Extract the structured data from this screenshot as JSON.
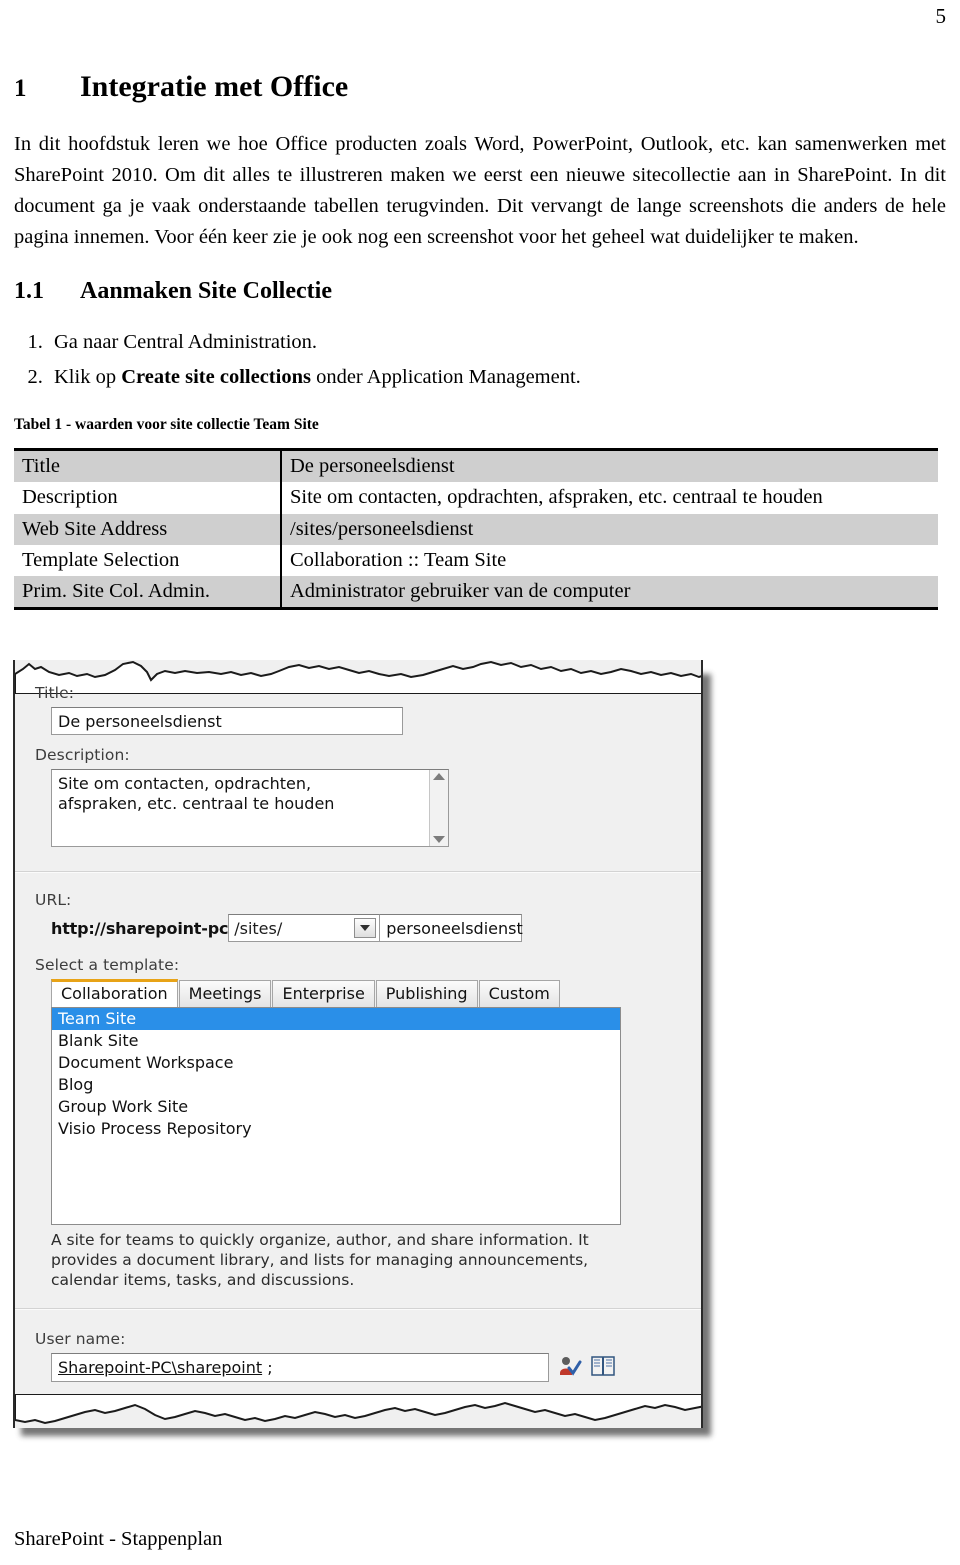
{
  "page": {
    "number": "5",
    "footer": "SharePoint - Stappenplan"
  },
  "chapter": {
    "number": "1",
    "title": "Integratie met Office",
    "intro": "In dit hoofdstuk leren we hoe Office producten zoals Word, PowerPoint, Outlook, etc. kan samenwerken met SharePoint 2010. Om dit alles te illustreren maken we eerst een nieuwe sitecollectie aan in SharePoint. In dit document ga je vaak onderstaande tabellen terugvinden. Dit vervangt de lange screenshots die anders de hele pagina innemen. Voor één keer zie je ook nog een screenshot voor het geheel wat duidelijker te maken."
  },
  "section": {
    "number": "1.1",
    "title": "Aanmaken Site Collectie",
    "steps": [
      {
        "plain_before": "Ga naar Central Administration.",
        "bold": "",
        "plain_after": ""
      },
      {
        "plain_before": "Klik op ",
        "bold": "Create site collections",
        "plain_after": " onder Application Management."
      }
    ]
  },
  "table": {
    "caption": "Tabel 1 - waarden voor site collectie Team Site",
    "rows": [
      {
        "key": "Title",
        "value": "De personeelsdienst"
      },
      {
        "key": "Description",
        "value": "Site om contacten, opdrachten, afspraken, etc. centraal te houden"
      },
      {
        "key": "Web Site Address",
        "value": "/sites/personeelsdienst"
      },
      {
        "key": "Template Selection",
        "value": "Collaboration :: Team Site"
      },
      {
        "key": "Prim. Site Col. Admin.",
        "value": "Administrator gebruiker van de computer"
      }
    ]
  },
  "screenshot": {
    "title_label": "Title:",
    "title_value": "De personeelsdienst",
    "description_label": "Description:",
    "description_value": "Site om contacten, opdrachten,\nafspraken, etc. centraal te houden",
    "url_label": "URL:",
    "url_prefix": "http://sharepoint-pc",
    "url_path": "/sites/",
    "url_tail": "personeelsdienst",
    "template_label": "Select a template:",
    "tabs": [
      {
        "label": "Collaboration",
        "active": true
      },
      {
        "label": "Meetings",
        "active": false
      },
      {
        "label": "Enterprise",
        "active": false
      },
      {
        "label": "Publishing",
        "active": false
      },
      {
        "label": "Custom",
        "active": false
      }
    ],
    "templates": [
      {
        "label": "Team Site",
        "selected": true
      },
      {
        "label": "Blank Site",
        "selected": false
      },
      {
        "label": "Document Workspace",
        "selected": false
      },
      {
        "label": "Blog",
        "selected": false
      },
      {
        "label": "Group Work Site",
        "selected": false
      },
      {
        "label": "Visio Process Repository",
        "selected": false
      }
    ],
    "template_description": "A site for teams to quickly organize, author, and share information. It provides a document library, and lists for managing announcements, calendar items, tasks, and discussions.",
    "username_label": "User name:",
    "username_value": "Sharepoint-PC\\sharepoint",
    "username_suffix": " ;",
    "icons": {
      "check_names": "check-names-icon",
      "address_book": "address-book-icon"
    },
    "colors": {
      "selection_blue": "#2a8fe8",
      "active_tab_accent": "#e8a317",
      "panel_bg": "#f0f0f0"
    }
  }
}
